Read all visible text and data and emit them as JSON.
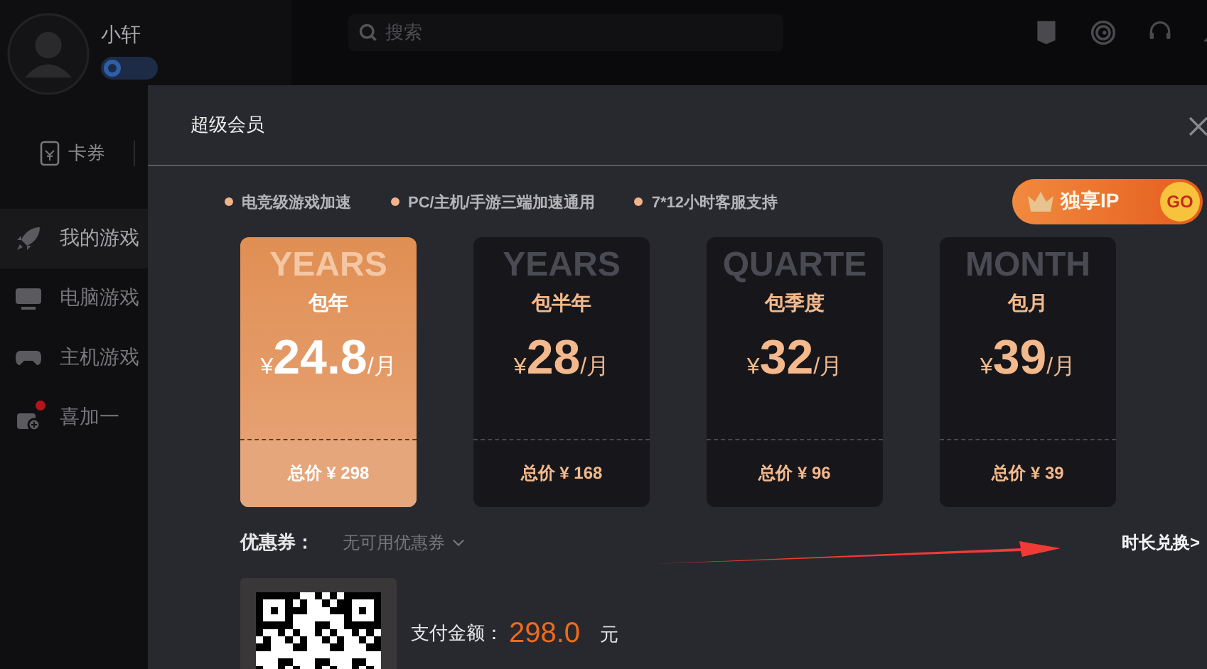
{
  "topbar": {
    "search": {
      "placeholder": "搜索"
    }
  },
  "sidebar": {
    "user": {
      "name": "小轩"
    },
    "coupon_link": "卡券",
    "items": [
      {
        "label": "我的游戏",
        "kind": "rocket",
        "selected": true,
        "badge": false
      },
      {
        "label": "电脑游戏",
        "kind": "pc",
        "selected": false,
        "badge": false
      },
      {
        "label": "主机游戏",
        "kind": "gamepad",
        "selected": false,
        "badge": false
      },
      {
        "label": "喜加一",
        "kind": "gift",
        "selected": false,
        "badge": true
      }
    ]
  },
  "modal": {
    "title": "超级会员",
    "features": [
      "电竞级游戏加速",
      "PC/主机/手游三端加速通用",
      "7*12小时客服支持"
    ],
    "promo": {
      "label": "独享IP",
      "go": "GO"
    },
    "plans": [
      {
        "watermark": "YEARS",
        "name": "包年",
        "currency": "¥",
        "price": "24.8",
        "unit": "/月",
        "total": "总价 ¥ 298",
        "selected": true
      },
      {
        "watermark": "YEARS",
        "name": "包半年",
        "currency": "¥",
        "price": "28",
        "unit": "/月",
        "total": "总价 ¥ 168",
        "selected": false
      },
      {
        "watermark": "QUARTE",
        "name": "包季度",
        "currency": "¥",
        "price": "32",
        "unit": "/月",
        "total": "总价 ¥ 96",
        "selected": false
      },
      {
        "watermark": "MONTH",
        "name": "包月",
        "currency": "¥",
        "price": "39",
        "unit": "/月",
        "total": "总价 ¥ 39",
        "selected": false
      }
    ],
    "coupon": {
      "label": "优惠券：",
      "value": "无可用优惠券"
    },
    "exchange_link": "时长兑换>",
    "payment": {
      "label": "支付金额：",
      "amount": "298.0",
      "unit": "元"
    }
  }
}
